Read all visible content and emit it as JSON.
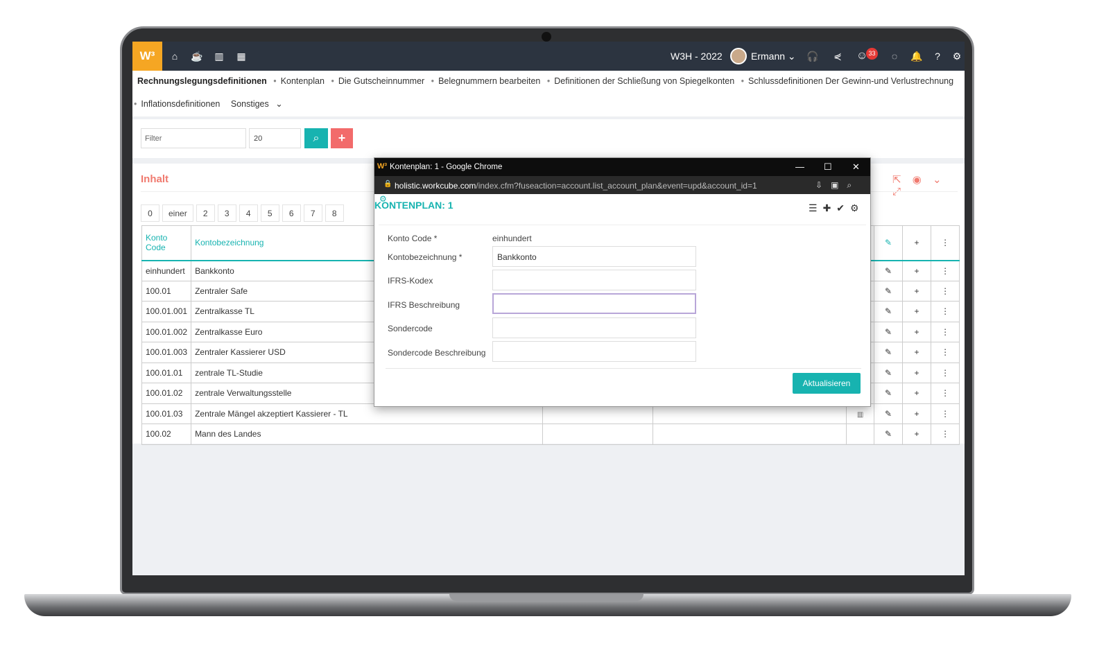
{
  "topbar": {
    "logo": "W³",
    "period": "W3H - 2022",
    "user": "Ermann",
    "notification_count": "33"
  },
  "menu": {
    "line1": [
      "Rechnungslegungsdefinitionen",
      "Kontenplan",
      "Die Gutscheinnummer",
      "Belegnummern bearbeiten",
      "Definitionen der Schließung von Spiegelkonten",
      "Schlussdefinitionen Der Gewinn-und Verlustrechnung"
    ],
    "line2": [
      "Inflationsdefinitionen"
    ],
    "more": "Sonstiges"
  },
  "filter": {
    "placeholder": "Filter",
    "rows": "20"
  },
  "content": {
    "title": "Inhalt",
    "pager": [
      "0",
      "einer",
      "2",
      "3",
      "4",
      "5",
      "6",
      "7",
      "8"
    ],
    "columns": {
      "code": "Konto Code",
      "name": "Kontobezeichnung"
    },
    "rows": [
      {
        "code": "einhundert",
        "name": "Bankkonto"
      },
      {
        "code": "100.01",
        "name": "Zentraler Safe"
      },
      {
        "code": "100.01.001",
        "name": "Zentralkasse TL"
      },
      {
        "code": "100.01.002",
        "name": "Zentralkasse Euro"
      },
      {
        "code": "100.01.003",
        "name": "Zentraler Kassierer USD"
      },
      {
        "code": "100.01.01",
        "name": "zentrale TL-Studie"
      },
      {
        "code": "100.01.02",
        "name": "zentrale Verwaltungsstelle"
      },
      {
        "code": "100.01.03",
        "name": "Zentrale Mängel akzeptiert Kassierer - TL"
      },
      {
        "code": "100.02",
        "name": "Mann des Landes"
      }
    ]
  },
  "popup": {
    "window_title": "Kontenplan: 1 - Google Chrome",
    "url_host": "holistic.workcube.com",
    "url_path": "/index.cfm?fuseaction=account.list_account_plan&event=upd&account_id=1",
    "heading": "KONTENPLAN: 1",
    "form": {
      "konto_code_label": "Konto Code *",
      "konto_code_value": "einhundert",
      "kontobezeichnung_label": "Kontobezeichnung *",
      "kontobezeichnung_value": "Bankkonto",
      "ifrs_kodex_label": "IFRS-Kodex",
      "ifrs_beschreibung_label": "IFRS Beschreibung",
      "sondercode_label": "Sondercode",
      "sondercode_beschreibung_label": "Sondercode Beschreibung"
    },
    "submit": "Aktualisieren"
  }
}
